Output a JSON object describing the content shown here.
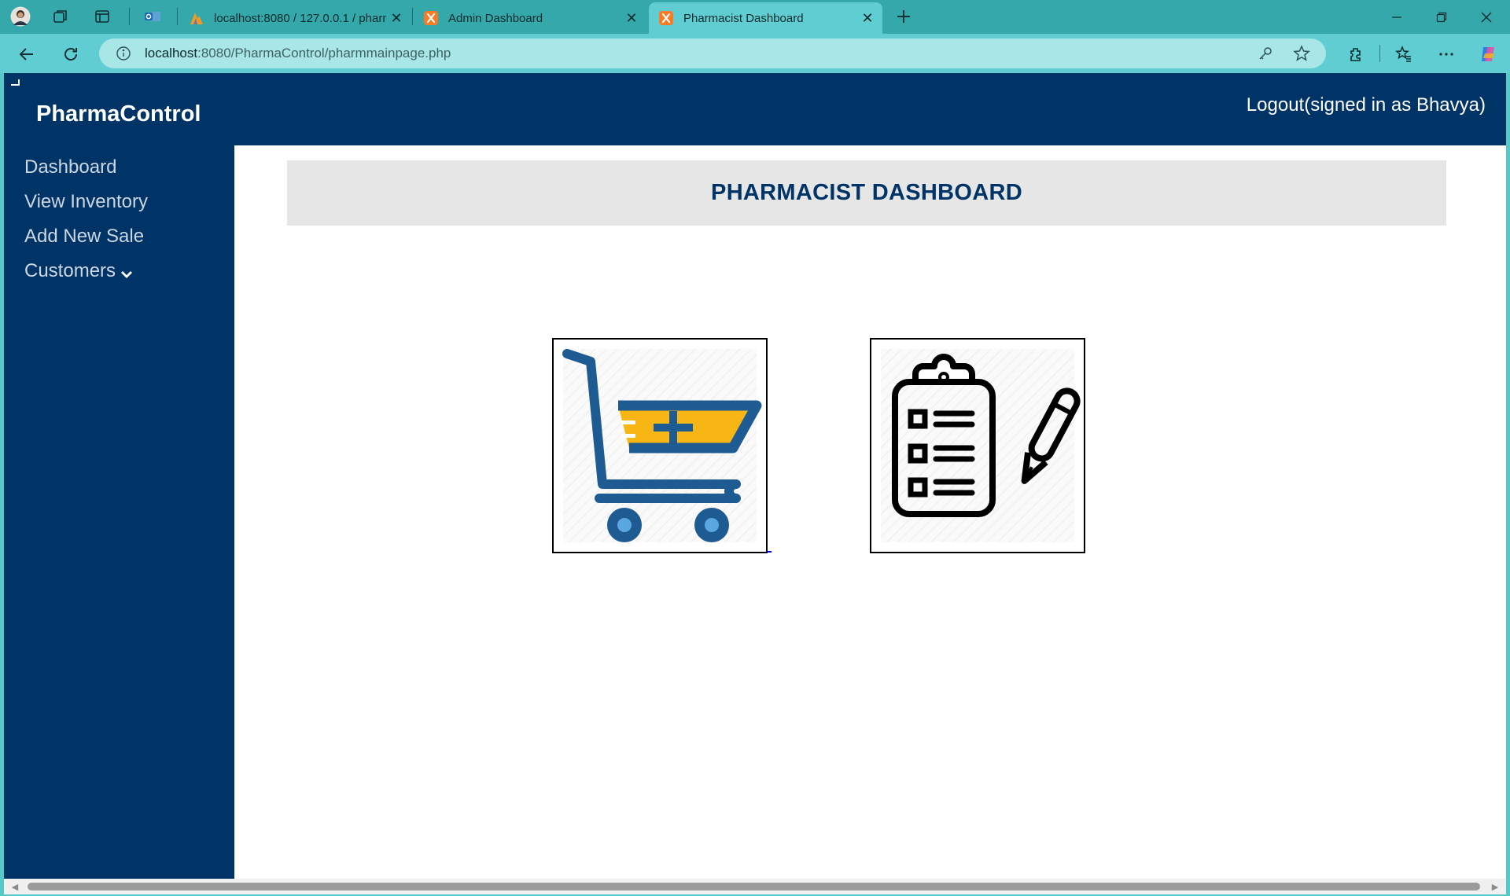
{
  "browser": {
    "tabs": [
      {
        "title": "localhost:8080 / 127.0.0.1 / pharm",
        "favicon": "phpmyadmin-icon",
        "active": false
      },
      {
        "title": "Admin Dashboard",
        "favicon": "xampp-icon",
        "active": false
      },
      {
        "title": "Pharmacist Dashboard",
        "favicon": "xampp-icon",
        "active": true
      }
    ],
    "url_host": "localhost",
    "url_rest": ":8080/PharmaControl/pharmmainpage.php"
  },
  "page": {
    "brand": "PharmaControl",
    "logout_text": "Logout(signed in as Bhavya)",
    "sidebar": {
      "items": [
        {
          "label": "Dashboard"
        },
        {
          "label": "View Inventory"
        },
        {
          "label": "Add New Sale"
        },
        {
          "label": "Customers",
          "has_dropdown": true
        }
      ]
    },
    "header_title": "PHARMACIST DASHBOARD",
    "tiles": [
      {
        "icon": "cart-plus-icon",
        "action": "add new sale"
      },
      {
        "icon": "clipboard-checklist-icon",
        "action": "view inventory"
      }
    ]
  },
  "colors": {
    "navy": "#003366",
    "header_bg": "#e6e6e6",
    "tab_bar": "#35a8ab",
    "cart_blue": "#1f5b93",
    "cart_yellow": "#f7b614",
    "cart_light": "#5aa6e0"
  }
}
